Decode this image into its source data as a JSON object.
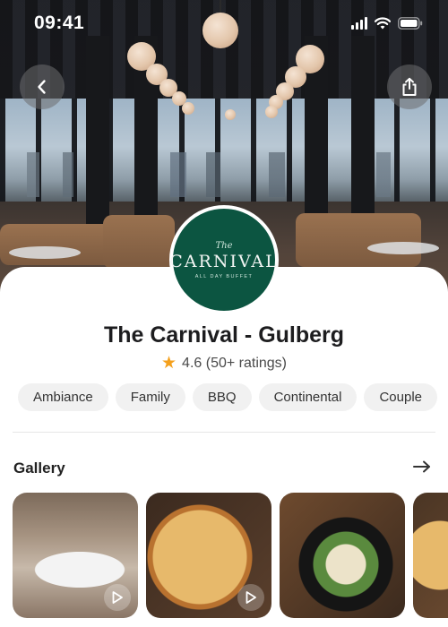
{
  "status_bar": {
    "time": "09:41",
    "icons": [
      "cellular-signal-icon",
      "wifi-icon",
      "battery-icon"
    ]
  },
  "header": {
    "back_icon": "chevron-left-icon",
    "share_icon": "share-icon"
  },
  "restaurant": {
    "logo": {
      "small_text": "The",
      "name": "CARNIVAL",
      "subtitle": "ALL DAY BUFFET",
      "color": "#0c5541"
    },
    "name": "The Carnival - Gulberg",
    "rating": "4.6 (50+ ratings)",
    "rating_star_color": "#f4a01c",
    "tags": [
      "Ambiance",
      "Family",
      "BBQ",
      "Continental",
      "Couple"
    ]
  },
  "gallery": {
    "title": "Gallery",
    "arrow_icon": "arrow-right-icon",
    "items": [
      {
        "label": "fine dining plate",
        "has_play": true
      },
      {
        "label": "pizza",
        "has_play": true
      },
      {
        "label": "salad with egg",
        "has_play": false
      },
      {
        "label": "pizza",
        "has_play": false
      }
    ]
  }
}
